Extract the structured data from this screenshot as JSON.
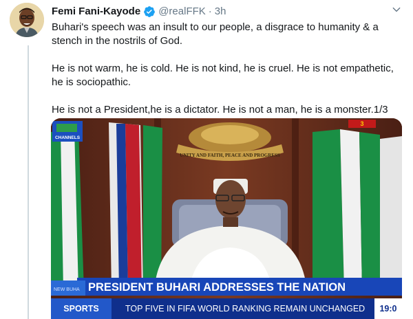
{
  "tweet": {
    "author_name": "Femi Fani-Kayode",
    "handle": "@realFFK",
    "separator": "·",
    "timestamp": "3h",
    "paragraphs": [
      "Buhari's speech was an insult to our people, a disgrace to humanity & a stench in the nostrils of God.",
      "He is not warm, he is cold. He is not kind, he is cruel. He is not empathetic, he is sociopathic.",
      "He is not a President,he is a dictator. He is not a man, he is a monster.1/3"
    ]
  },
  "media": {
    "channel_logo_text": "CHANNELS",
    "crest_motto": "UNITY AND FAITH, PEACE AND PROGRESS",
    "headline": "PRESIDENT BUHARI ADDRESSES THE NATION",
    "strip_label_left": "NEW BUHA",
    "ticker_section": "SPORTS",
    "ticker_text": "TOP FIVE IN FIFA WORLD RANKING REMAIN UNCHANGED",
    "clock": "19:0",
    "corner_text": "3"
  },
  "icons": {
    "verified": "verified-badge-icon",
    "more": "chevron-down-icon"
  },
  "colors": {
    "verified_blue": "#1da1f2",
    "secondary_text": "#657786",
    "headline_bar": "#1846b8",
    "ticker_bar": "#0f2f8c",
    "flag_green": "#0f8a3c"
  }
}
